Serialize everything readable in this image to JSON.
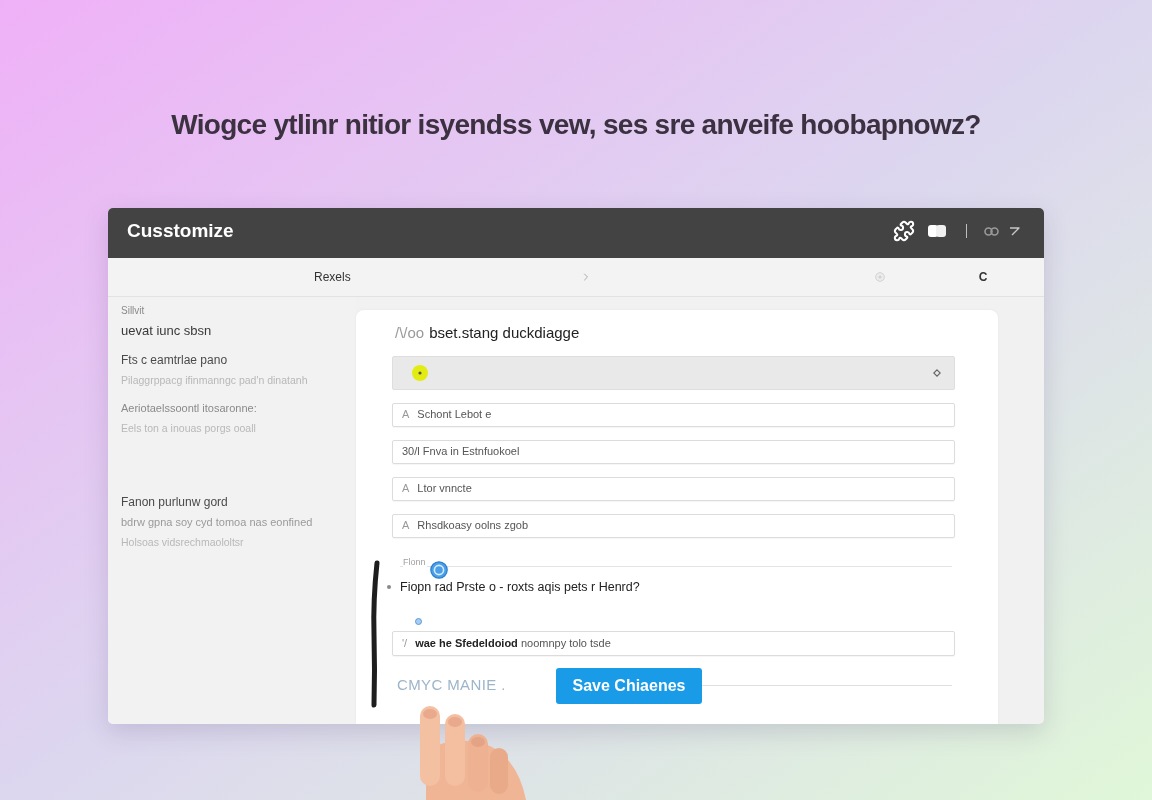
{
  "headline": "Wiogce ytlinr nitior isyendss vew, ses sre anveife hoobapnowz?",
  "window": {
    "title": "Cusstomize"
  },
  "toolbar": {
    "breadcrumb": "Rexels",
    "trailing": "C"
  },
  "sidebar": {
    "sections": [
      {
        "lines": [
          {
            "kind": "caption",
            "text": "Sillvit"
          },
          {
            "kind": "title",
            "text": "uevat iunc sbsn"
          }
        ]
      },
      {
        "lines": [
          {
            "kind": "heading",
            "text": "Fts c eamtrlae pano"
          },
          {
            "kind": "hint",
            "text": "Pilaggrppacg ifinmanngc pad'n dinatanh"
          }
        ]
      },
      {
        "lines": [
          {
            "kind": "subheading",
            "text": "Aeriotaelssoontl itosaronne:"
          },
          {
            "kind": "hint",
            "text": "Eels ton a inouas porgs ooall"
          }
        ]
      },
      {
        "lines": [
          {
            "kind": "heading",
            "text": "Fanon purlunw gord"
          },
          {
            "kind": "text",
            "text": "bdrw gpna soy cyd tomoa nas eonfined"
          },
          {
            "kind": "hint",
            "text": "Holsoas vidsrechmaololtsr"
          }
        ]
      }
    ]
  },
  "form": {
    "heading_prefix": "/\\/oo",
    "heading": "bset.stang duckdiagge",
    "fields": [
      {
        "prefix": "A",
        "value": "Schont Lebot e"
      },
      {
        "value": "30/l Fnva in Estnfuokoel"
      },
      {
        "prefix": "A",
        "value": "Ltor vnncte"
      },
      {
        "prefix": "A",
        "value": "Rhsdkoasy oolns zgob"
      }
    ],
    "question": {
      "label": "Flonn",
      "text": "Fiopn rad Prste o - roxts aqis pets r Henrd?"
    },
    "note_field": {
      "prefix": "'/",
      "value": "**wae he Sfedeldoiod** noomnpy tolo tsde"
    },
    "link": "CMYC MANIE .",
    "save_button": "Save Chiaenes"
  }
}
